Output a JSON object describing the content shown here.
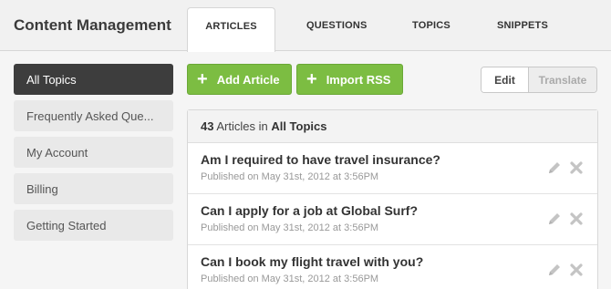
{
  "app": {
    "title": "Content Management"
  },
  "tabs": [
    {
      "label": "ARTICLES",
      "active": true
    },
    {
      "label": "QUESTIONS"
    },
    {
      "label": "TOPICS"
    },
    {
      "label": "SNIPPETS"
    }
  ],
  "sidebar": {
    "items": [
      {
        "label": "All Topics",
        "active": true
      },
      {
        "label": "Frequently Asked Que..."
      },
      {
        "label": "My Account"
      },
      {
        "label": "Billing"
      },
      {
        "label": "Getting Started"
      }
    ]
  },
  "toolbar": {
    "add_label": "Add Article",
    "import_label": "Import RSS",
    "edit_label": "Edit",
    "translate_label": "Translate"
  },
  "list": {
    "count": "43",
    "count_suffix": " Articles in ",
    "scope": "All Topics",
    "articles": [
      {
        "title": "Am I required to have travel insurance?",
        "meta": "Published on May 31st, 2012 at 3:56PM"
      },
      {
        "title": "Can I apply for a job at Global Surf?",
        "meta": "Published on May 31st, 2012 at 3:56PM"
      },
      {
        "title": "Can I book my flight travel with you?",
        "meta": "Published on May 31st, 2012 at 3:56PM"
      }
    ]
  },
  "icons": {
    "edit": "pencil-icon",
    "delete": "close-icon",
    "add": "plus-icon"
  },
  "colors": {
    "accent_green": "#7cbd42",
    "active_dark": "#3d3d3d",
    "icon_gray": "#c4c4c4"
  }
}
